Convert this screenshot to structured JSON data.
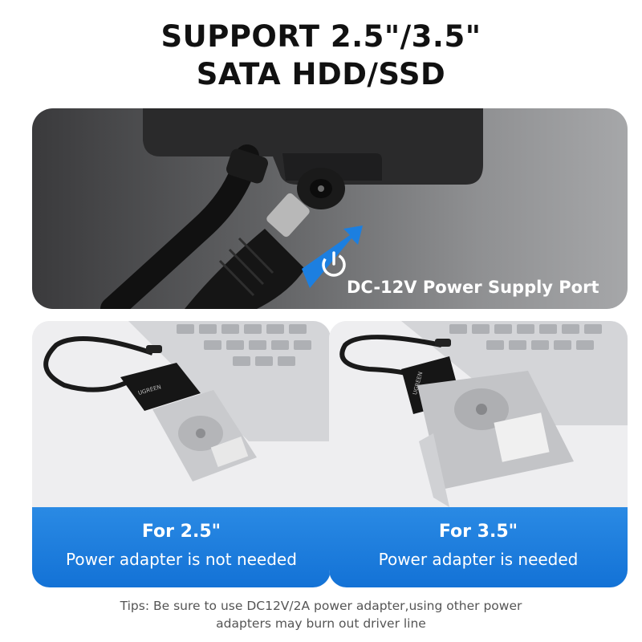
{
  "title": {
    "line1": "SUPPORT 2.5\"/3.5\"",
    "line2": "SATA HDD/SSD"
  },
  "hero": {
    "caption": "DC-12V Power Supply Port",
    "icon": "power-icon",
    "colors": {
      "arrow": "#1c7fe0",
      "background_dark": "#3a3a3c",
      "background_light": "#a6a7a9"
    }
  },
  "panels": [
    {
      "title": "For 2.5\"",
      "subtitle": "Power adapter is not needed",
      "brand": "UGREEN"
    },
    {
      "title": "For 3.5\"",
      "subtitle": "Power adapter is needed",
      "brand": "UGREEN"
    }
  ],
  "tips": {
    "line1": "Tips: Be sure to use DC12V/2A power adapter,using other power",
    "line2": "adapters may burn out driver line"
  },
  "colors": {
    "accent_blue": "#1372d6",
    "text_dark": "#111111",
    "tips_gray": "#555555"
  }
}
